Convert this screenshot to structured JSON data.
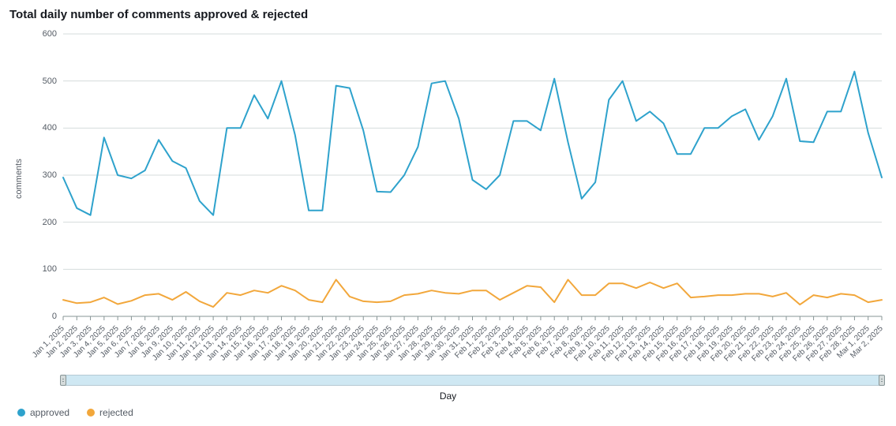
{
  "title": "Total daily number of comments approved & rejected",
  "xlabel": "Day",
  "ylabel": "comments",
  "legend": {
    "approved": "approved",
    "rejected": "rejected"
  },
  "colors": {
    "approved": "#2ea2cc",
    "rejected": "#f2a73b",
    "grid": "#d5dbdb",
    "axis": "#879596"
  },
  "chart_data": {
    "type": "line",
    "title": "Total daily number of comments approved & rejected",
    "xlabel": "Day",
    "ylabel": "comments",
    "ylim": [
      0,
      600
    ],
    "y_ticks": [
      0,
      100,
      200,
      300,
      400,
      500,
      600
    ],
    "categories": [
      "Jan 1, 2025",
      "Jan 2, 2025",
      "Jan 3, 2025",
      "Jan 4, 2025",
      "Jan 5, 2025",
      "Jan 6, 2025",
      "Jan 7, 2025",
      "Jan 8, 2025",
      "Jan 9, 2025",
      "Jan 10, 2025",
      "Jan 11, 2025",
      "Jan 12, 2025",
      "Jan 13, 2025",
      "Jan 14, 2025",
      "Jan 15, 2025",
      "Jan 16, 2025",
      "Jan 17, 2025",
      "Jan 18, 2025",
      "Jan 19, 2025",
      "Jan 20, 2025",
      "Jan 21, 2025",
      "Jan 22, 2025",
      "Jan 23, 2025",
      "Jan 24, 2025",
      "Jan 25, 2025",
      "Jan 26, 2025",
      "Jan 27, 2025",
      "Jan 28, 2025",
      "Jan 29, 2025",
      "Jan 30, 2025",
      "Jan 31, 2025",
      "Feb 1, 2025",
      "Feb 2, 2025",
      "Feb 3, 2025",
      "Feb 4, 2025",
      "Feb 5, 2025",
      "Feb 6, 2025",
      "Feb 7, 2025",
      "Feb 8, 2025",
      "Feb 9, 2025",
      "Feb 10, 2025",
      "Feb 11, 2025",
      "Feb 12, 2025",
      "Feb 13, 2025",
      "Feb 14, 2025",
      "Feb 15, 2025",
      "Feb 16, 2025",
      "Feb 17, 2025",
      "Feb 18, 2025",
      "Feb 19, 2025",
      "Feb 20, 2025",
      "Feb 21, 2025",
      "Feb 22, 2025",
      "Feb 23, 2025",
      "Feb 24, 2025",
      "Feb 25, 2025",
      "Feb 26, 2025",
      "Feb 27, 2025",
      "Feb 28, 2025",
      "Mar 1, 2025",
      "Mar 2, 2025"
    ],
    "series": [
      {
        "name": "approved",
        "color": "#2ea2cc",
        "values": [
          295,
          230,
          215,
          380,
          300,
          293,
          310,
          375,
          330,
          315,
          245,
          215,
          400,
          400,
          470,
          420,
          500,
          385,
          225,
          225,
          490,
          485,
          395,
          265,
          264,
          300,
          360,
          495,
          500,
          420,
          290,
          270,
          300,
          415,
          415,
          395,
          505,
          370,
          250,
          285,
          460,
          500,
          415,
          435,
          410,
          345,
          345,
          400,
          400,
          425,
          440,
          375,
          425,
          505,
          372,
          370,
          435,
          435,
          520,
          390,
          295
        ]
      },
      {
        "name": "rejected",
        "color": "#f2a73b",
        "values": [
          35,
          28,
          30,
          40,
          26,
          33,
          45,
          48,
          35,
          52,
          32,
          20,
          50,
          45,
          55,
          50,
          65,
          55,
          35,
          30,
          78,
          42,
          32,
          30,
          32,
          45,
          48,
          55,
          50,
          48,
          55,
          55,
          35,
          50,
          65,
          62,
          30,
          78,
          45,
          45,
          70,
          70,
          60,
          72,
          60,
          70,
          40,
          42,
          45,
          45,
          48,
          48,
          42,
          50,
          25,
          45,
          40,
          48,
          45,
          30,
          35
        ]
      }
    ],
    "legend_position": "bottom-left"
  }
}
